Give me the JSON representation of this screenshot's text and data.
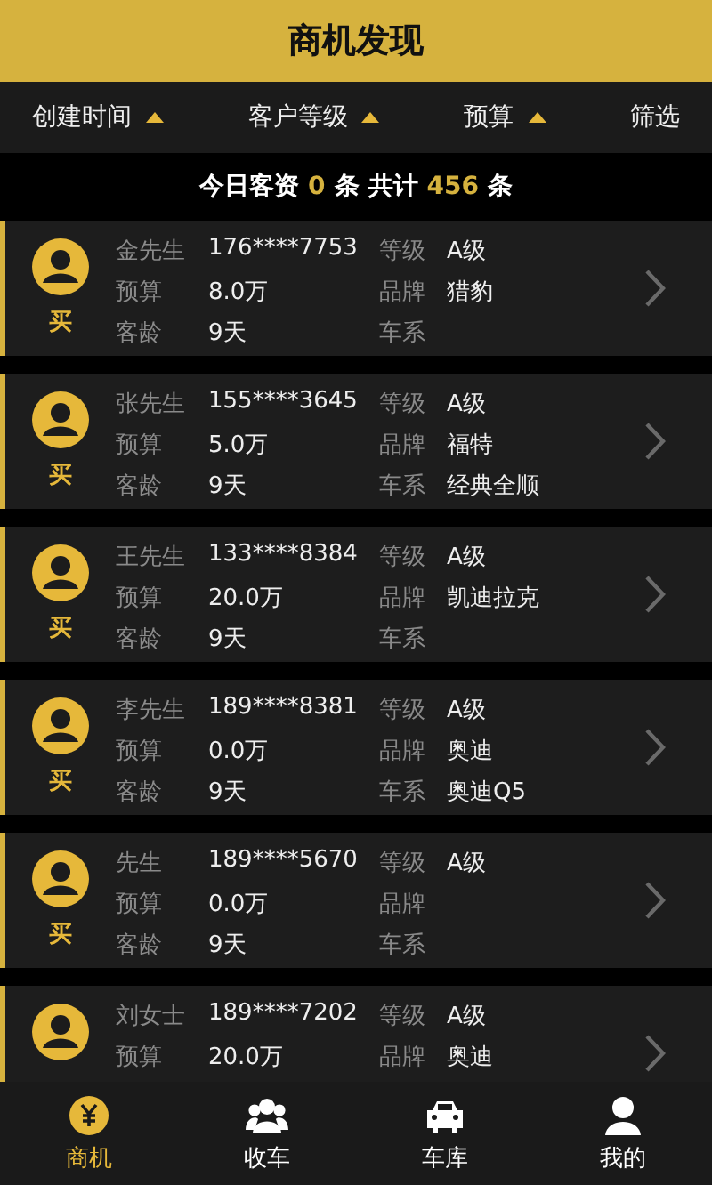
{
  "header": {
    "title": "商机发现"
  },
  "sort_bar": [
    {
      "label": "创建时间",
      "kind": "sort"
    },
    {
      "label": "客户等级",
      "kind": "sort"
    },
    {
      "label": "预算",
      "kind": "sort"
    },
    {
      "label": "筛选",
      "kind": "filter"
    }
  ],
  "summary": {
    "today_label": "今日客资",
    "today_count": "0",
    "unit1": "条",
    "total_label": "共计",
    "total_count": "456",
    "unit2": "条"
  },
  "cards": [
    {
      "tag": "买",
      "rows": [
        {
          "left_label": "金先生",
          "left_value": "176****7753",
          "right_label": "等级",
          "right_value": "A级"
        },
        {
          "left_label": "预算",
          "left_value": "8.0万",
          "right_label": "品牌",
          "right_value": "猎豹"
        },
        {
          "left_label": "客龄",
          "left_value": "9天",
          "right_label": "车系"
        }
      ]
    },
    {
      "tag": "买",
      "rows": [
        {
          "left_label": "张先生",
          "left_value": "155****3645",
          "right_label": "等级",
          "right_value": "A级"
        },
        {
          "left_label": "预算",
          "left_value": "5.0万",
          "right_label": "品牌",
          "right_value": "福特"
        },
        {
          "left_label": "客龄",
          "left_value": "9天",
          "right_label": "车系",
          "right_value": "经典全顺"
        }
      ]
    },
    {
      "tag": "买",
      "rows": [
        {
          "left_label": "王先生",
          "left_value": "133****8384",
          "right_label": "等级",
          "right_value": "A级"
        },
        {
          "left_label": "预算",
          "left_value": "20.0万",
          "right_label": "品牌",
          "right_value": "凯迪拉克"
        },
        {
          "left_label": "客龄",
          "left_value": "9天",
          "right_label": "车系"
        }
      ]
    },
    {
      "tag": "买",
      "rows": [
        {
          "left_label": "李先生",
          "left_value": "189****8381",
          "right_label": "等级",
          "right_value": "A级"
        },
        {
          "left_label": "预算",
          "left_value": "0.0万",
          "right_label": "品牌",
          "right_value": "奥迪"
        },
        {
          "left_label": "客龄",
          "left_value": "9天",
          "right_label": "车系",
          "right_value": "奥迪Q5"
        }
      ]
    },
    {
      "tag": "买",
      "rows": [
        {
          "left_label": "先生",
          "left_value": "189****5670",
          "right_label": "等级",
          "right_value": "A级"
        },
        {
          "left_label": "预算",
          "left_value": "0.0万",
          "right_label": "品牌"
        },
        {
          "left_label": "客龄",
          "left_value": "9天",
          "right_label": "车系"
        }
      ]
    },
    {
      "rows": [
        {
          "left_label": "刘女士",
          "left_value": "189****7202",
          "right_label": "等级",
          "right_value": "A级"
        },
        {
          "left_label": "预算",
          "left_value": "20.0万",
          "right_label": "品牌",
          "right_value": "奥迪"
        }
      ]
    }
  ],
  "tab_bar": [
    {
      "label": "商机",
      "selected": true
    },
    {
      "label": "收车",
      "selected": false
    },
    {
      "label": "车库",
      "selected": false
    },
    {
      "label": "我的",
      "selected": false
    }
  ]
}
